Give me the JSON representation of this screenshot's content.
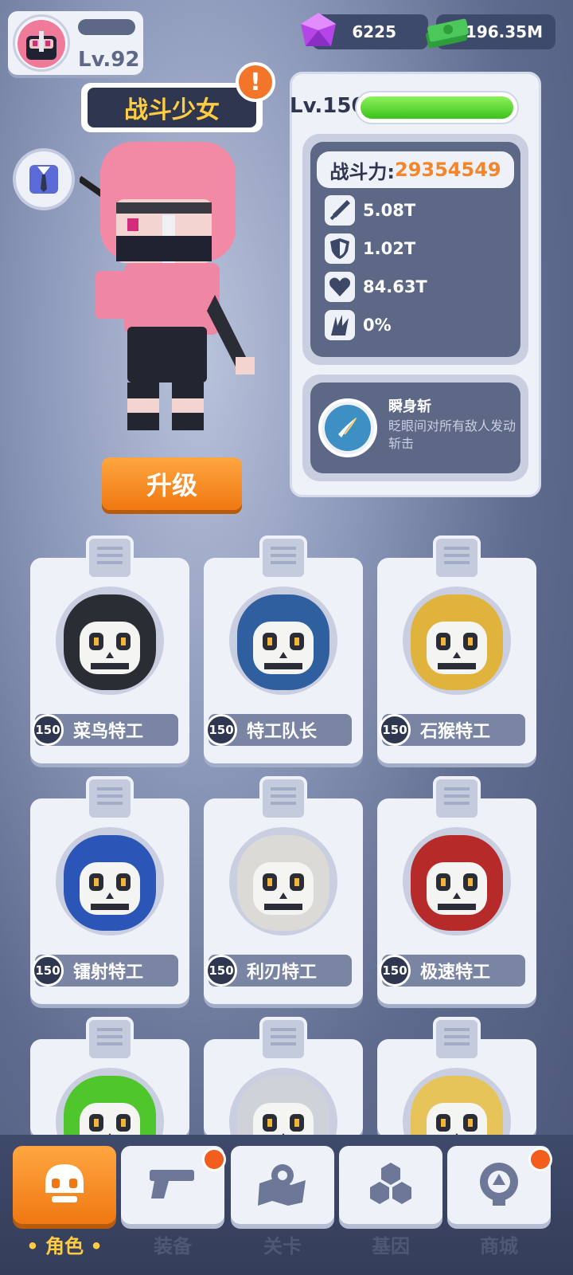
{
  "player": {
    "level": "Lv.92"
  },
  "currency": {
    "gems": "6225",
    "cash": "196.35M"
  },
  "hero": {
    "name": "战斗少女",
    "level": "Lv.150",
    "hp_fill": 1.0,
    "power_label": "战斗力:",
    "power_value": "29354549",
    "stats": [
      {
        "icon": "sword-icon",
        "value": "5.08T"
      },
      {
        "icon": "shield-icon",
        "value": "1.02T"
      },
      {
        "icon": "heart-icon",
        "value": "84.63T"
      },
      {
        "icon": "crit-claw-icon",
        "value": "0%"
      }
    ],
    "skill": {
      "name": "瞬身斩",
      "description": "眨眼间对所有敌人发动斩击"
    },
    "upgrade_label": "升级"
  },
  "agents": [
    {
      "name": "菜鸟特工",
      "level": "150",
      "hood": "#2b2d34"
    },
    {
      "name": "特工队长",
      "level": "150",
      "hood": "#2f5f9e"
    },
    {
      "name": "石猴特工",
      "level": "150",
      "hood": "#e0b43c"
    },
    {
      "name": "镭射特工",
      "level": "150",
      "hood": "#2c55b8"
    },
    {
      "name": "利刃特工",
      "level": "150",
      "hood": "#dcdad6"
    },
    {
      "name": "极速特工",
      "level": "150",
      "hood": "#b72a2a"
    },
    {
      "name": "",
      "level": "",
      "hood": "#4fc62c"
    },
    {
      "name": "",
      "level": "",
      "hood": "#cfd2d8"
    },
    {
      "name": "",
      "level": "",
      "hood": "#e6c45a"
    }
  ],
  "nav": [
    {
      "label": "角色",
      "icon": "skull-icon",
      "active": true,
      "badge": false
    },
    {
      "label": "装备",
      "icon": "gun-icon",
      "active": false,
      "badge": true
    },
    {
      "label": "关卡",
      "icon": "map-pin-icon",
      "active": false,
      "badge": false
    },
    {
      "label": "基因",
      "icon": "hexagons-icon",
      "active": false,
      "badge": false
    },
    {
      "label": "商城",
      "icon": "shop-icon",
      "active": false,
      "badge": true
    }
  ]
}
